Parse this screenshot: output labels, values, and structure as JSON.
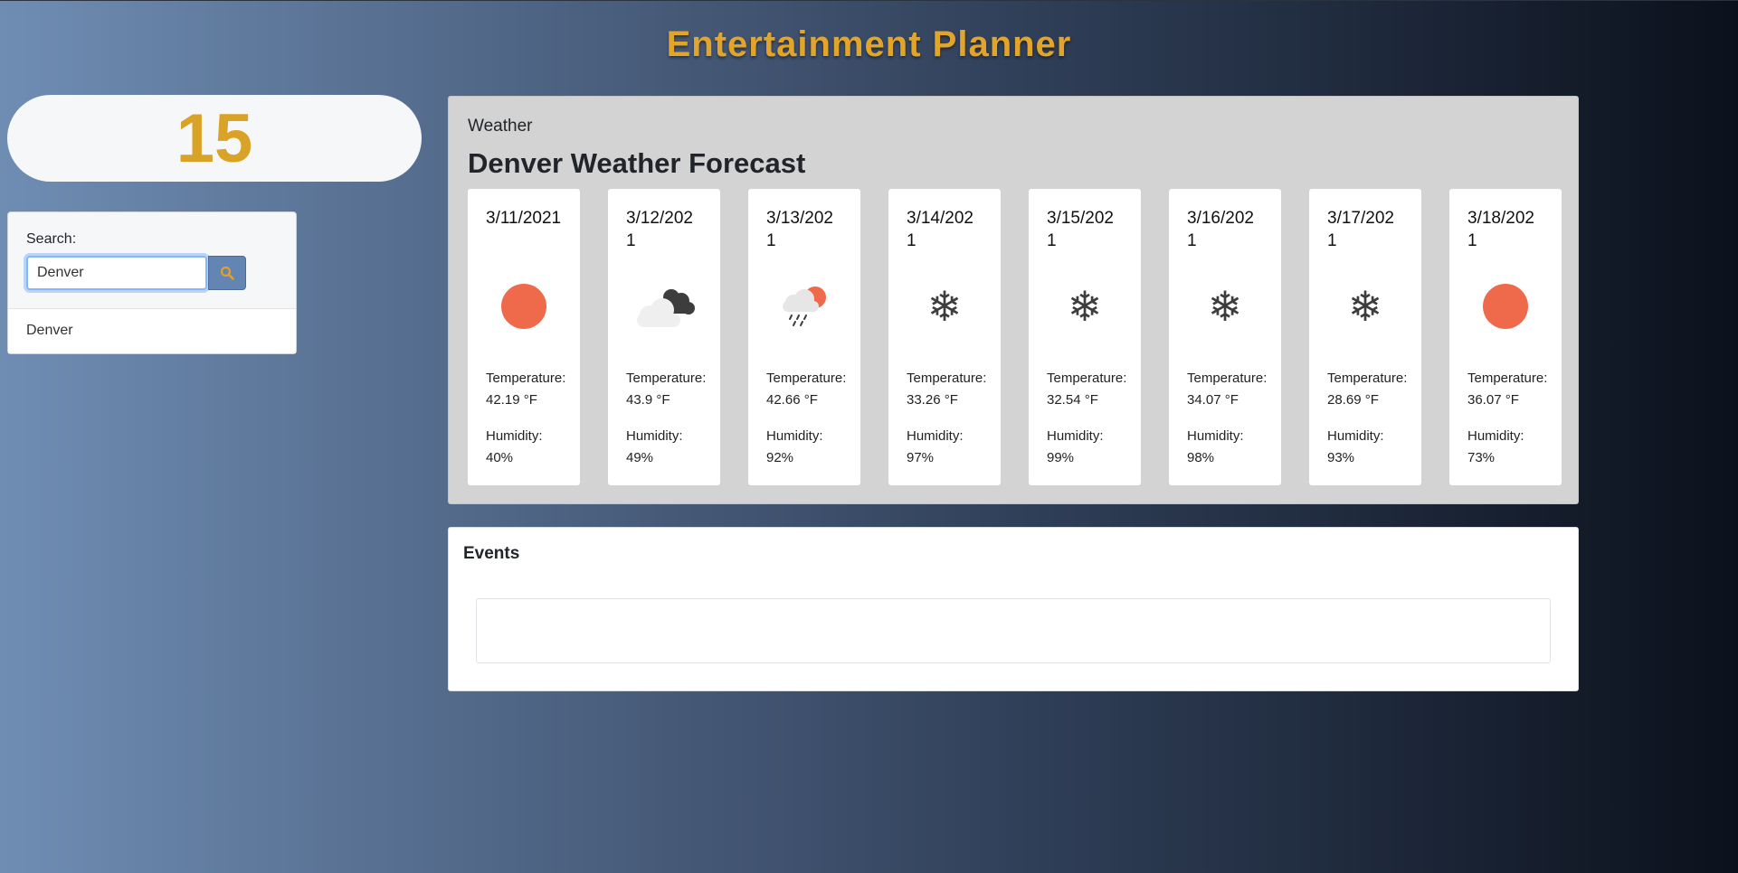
{
  "header": {
    "title": "Entertainment Planner"
  },
  "counter": {
    "value": "15"
  },
  "search": {
    "label": "Search:",
    "value": "Denver",
    "suggestions": [
      "Denver"
    ]
  },
  "weather": {
    "section_title": "Weather",
    "forecast_title": "Denver Weather Forecast",
    "days": [
      {
        "date": "3/11/2021",
        "icon": "sun-icon",
        "temperature": "Temperature: 42.19 °F",
        "humidity": "Humidity: 40%"
      },
      {
        "date": "3/12/2021",
        "icon": "cloud-dark-icon",
        "temperature": "Temperature: 43.9 °F",
        "humidity": "Humidity: 49%"
      },
      {
        "date": "3/13/2021",
        "icon": "rain-sun-icon",
        "temperature": "Temperature: 42.66 °F",
        "humidity": "Humidity: 92%"
      },
      {
        "date": "3/14/2021",
        "icon": "snowflake-icon",
        "temperature": "Temperature: 33.26 °F",
        "humidity": "Humidity: 97%"
      },
      {
        "date": "3/15/2021",
        "icon": "snowflake-icon",
        "temperature": "Temperature: 32.54 °F",
        "humidity": "Humidity: 99%"
      },
      {
        "date": "3/16/2021",
        "icon": "snowflake-icon",
        "temperature": "Temperature: 34.07 °F",
        "humidity": "Humidity: 98%"
      },
      {
        "date": "3/17/2021",
        "icon": "snowflake-icon",
        "temperature": "Temperature: 28.69 °F",
        "humidity": "Humidity: 93%"
      },
      {
        "date": "3/18/2021",
        "icon": "sun-icon",
        "temperature": "Temperature: 36.07 °F",
        "humidity": "Humidity: 73%"
      }
    ]
  },
  "events": {
    "title": "Events"
  },
  "colors": {
    "title": "#e2a52a",
    "counter": "#d9a328",
    "sun": "#ee6a4b",
    "search_button": "#6385b4",
    "search_icon": "#e0a030"
  }
}
